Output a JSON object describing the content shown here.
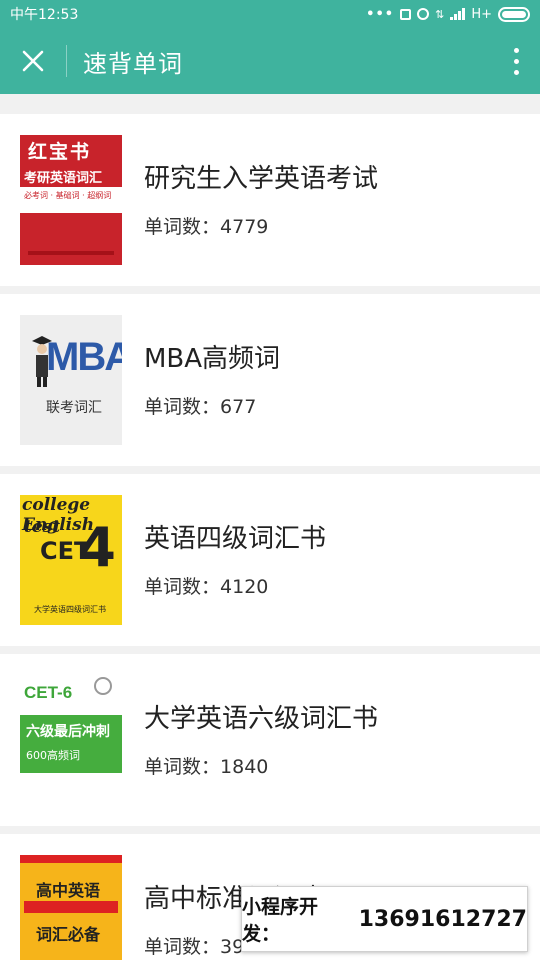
{
  "status_bar": {
    "left_text": "中午12:53",
    "network": "H+"
  },
  "nav": {
    "title": "速背单词"
  },
  "books": [
    {
      "title": "研究生入学英语考试",
      "count_label": "单词数：",
      "count": "4779",
      "cover": {
        "line1": "红宝书",
        "line2": "考研英语词汇",
        "line3": "必考词 · 基础词 · 超纲词"
      }
    },
    {
      "title": "MBA高频词",
      "count_label": "单词数：",
      "count": "677",
      "cover": {
        "line1": "MBA",
        "line2": "联考词汇"
      }
    },
    {
      "title": "英语四级词汇书",
      "count_label": "单词数：",
      "count": "4120",
      "cover": {
        "line1": "college English",
        "line2": "test",
        "line3": "CET",
        "line4": "4",
        "line5": "大学英语四级词汇书"
      }
    },
    {
      "title": "大学英语六级词汇书",
      "count_label": "单词数：",
      "count": "1840",
      "cover": {
        "line1": "CET-6",
        "line2": "六级最后冲刺",
        "line3": "600高频词"
      }
    },
    {
      "title": "高中标准词汇表",
      "count_label": "单词数：",
      "count": "39",
      "cover": {
        "line1": "高中英语",
        "line2": "词汇必备"
      }
    }
  ],
  "watermark": {
    "label": "小程序开发：",
    "phone": "13691612727"
  },
  "colors": {
    "header": "#3fb39e",
    "background": "#f1f1f1"
  },
  "icons": [
    "close-icon",
    "more-vertical-icon",
    "battery-icon",
    "signal-icon",
    "alarm-icon"
  ]
}
